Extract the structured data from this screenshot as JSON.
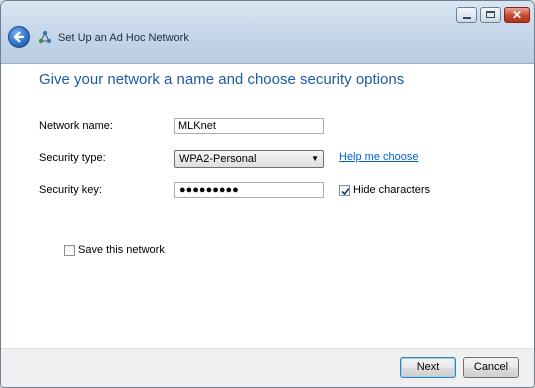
{
  "window": {
    "title": "Set Up an Ad Hoc Network",
    "controls": {
      "minimize": "minimize",
      "maximize": "maximize",
      "close": "✕"
    }
  },
  "heading": "Give your network a name and choose security options",
  "form": {
    "network_name": {
      "label": "Network name:",
      "value": "MLKnet"
    },
    "security_type": {
      "label": "Security type:",
      "value": "WPA2-Personal",
      "help_link": "Help me choose"
    },
    "security_key": {
      "label": "Security key:",
      "value": "●●●●●●●●●",
      "hide_characters_label": "Hide characters",
      "hide_characters_checked": true
    },
    "save_network": {
      "label": "Save this network",
      "checked": false
    }
  },
  "buttons": {
    "next": "Next",
    "cancel": "Cancel"
  },
  "icons": {
    "back": "back-arrow-icon",
    "wizard": "network-wizard-icon"
  }
}
